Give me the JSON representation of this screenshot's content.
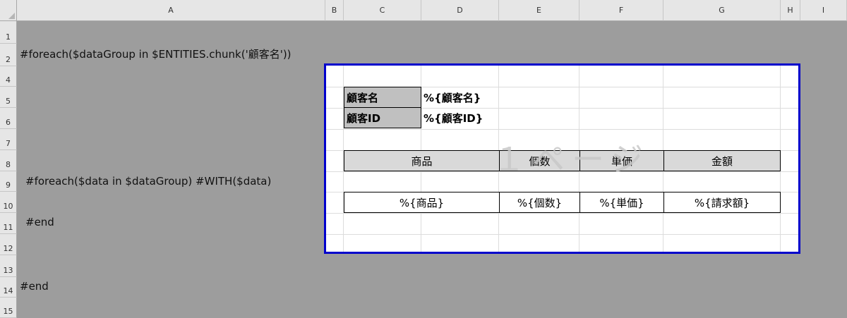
{
  "columns": [
    "A",
    "B",
    "C",
    "D",
    "E",
    "F",
    "G",
    "H",
    "I"
  ],
  "rows": [
    "1",
    "2",
    "4",
    "5",
    "6",
    "7",
    "8",
    "9",
    "10",
    "11",
    "12",
    "13",
    "14",
    "15"
  ],
  "cells": {
    "a2": "#foreach($dataGroup in $ENTITIES.chunk('顧客名'))",
    "a9": "#foreach($data in $dataGroup) #WITH($data)",
    "a11": "#end",
    "a14": "#end"
  },
  "template": {
    "customer_name_label": "顧客名",
    "customer_name_value": "%{顧客名}",
    "customer_id_label": "顧客ID",
    "customer_id_value": "%{顧客ID}",
    "headers": [
      "商品",
      "個数",
      "単価",
      "金額"
    ],
    "values": [
      "%{商品}",
      "%{個数}",
      "%{単価}",
      "%{請求額}"
    ]
  },
  "page_watermark": "１ページ",
  "colors": {
    "print_area_border": "#0000cc",
    "sheet_background": "#9d9d9d",
    "header_fill": "#d9d9d9"
  }
}
